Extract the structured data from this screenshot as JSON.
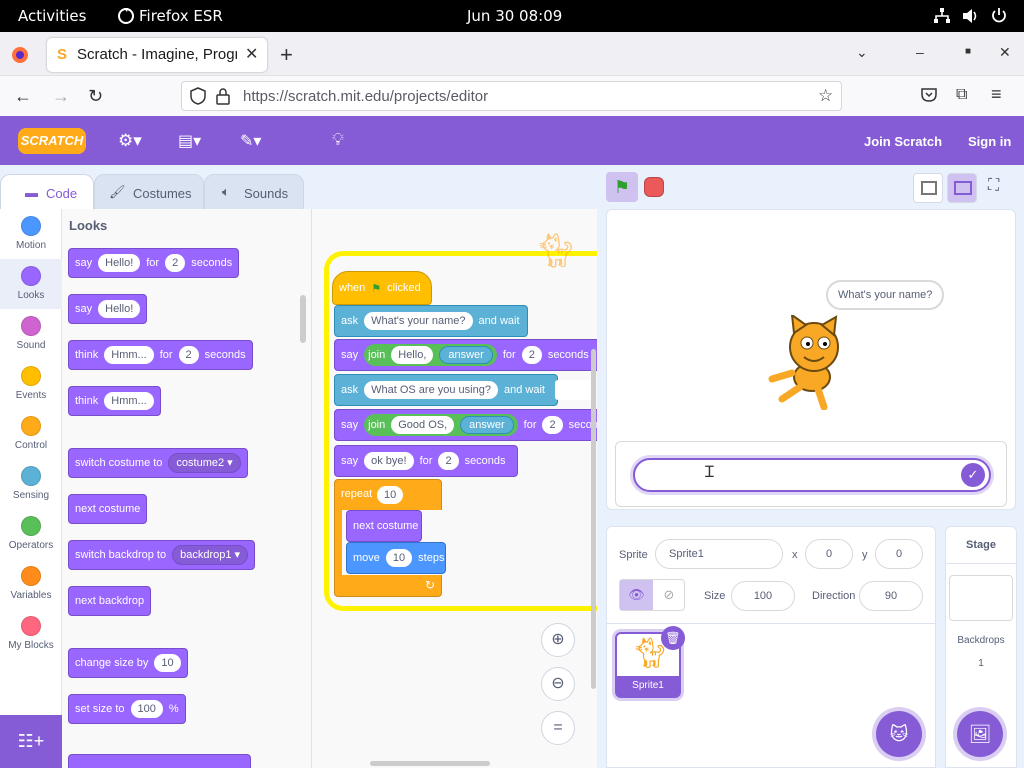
{
  "os": {
    "activities": "Activities",
    "app": "Firefox ESR",
    "clock": "Jun 30  08:09"
  },
  "browser": {
    "tab_title": "Scratch - Imagine, Progra",
    "url": "https://scratch.mit.edu/projects/editor",
    "new_tab": "+"
  },
  "scratch": {
    "logo": "SCRATCH",
    "join": "Join Scratch",
    "signin": "Sign in",
    "tabs": {
      "code": "Code",
      "costumes": "Costumes",
      "sounds": "Sounds"
    },
    "categories": [
      {
        "label": "Motion",
        "color": "#4c97ff"
      },
      {
        "label": "Looks",
        "color": "#9966ff"
      },
      {
        "label": "Sound",
        "color": "#cf63cf"
      },
      {
        "label": "Events",
        "color": "#ffbf00"
      },
      {
        "label": "Control",
        "color": "#ffab19"
      },
      {
        "label": "Sensing",
        "color": "#5cb1d6"
      },
      {
        "label": "Operators",
        "color": "#59c059"
      },
      {
        "label": "Variables",
        "color": "#ff8c1a"
      },
      {
        "label": "My Blocks",
        "color": "#ff6680"
      }
    ],
    "palette": {
      "heading": "Looks",
      "say_for": {
        "say": "say",
        "msg": "Hello!",
        "for": "for",
        "secs": "2",
        "seconds": "seconds"
      },
      "say": {
        "say": "say",
        "msg": "Hello!"
      },
      "think_for": {
        "think": "think",
        "msg": "Hmm...",
        "for": "for",
        "secs": "2",
        "seconds": "seconds"
      },
      "think": {
        "think": "think",
        "msg": "Hmm..."
      },
      "switch_costume": {
        "label": "switch costume to",
        "value": "costume2"
      },
      "next_costume": "next costume",
      "switch_backdrop": {
        "label": "switch backdrop to",
        "value": "backdrop1"
      },
      "next_backdrop": "next backdrop",
      "change_size": {
        "label": "change size by",
        "value": "10"
      },
      "set_size": {
        "label": "set size to",
        "value": "100",
        "unit": "%"
      }
    },
    "script": {
      "hat": {
        "when": "when",
        "clicked": "clicked"
      },
      "ask1": {
        "ask": "ask",
        "q": "What's your name?",
        "and_wait": "and wait"
      },
      "say1": {
        "say": "say",
        "join": "join",
        "a": "Hello,",
        "b": "answer",
        "for": "for",
        "secs": "2",
        "seconds": "seconds"
      },
      "ask2": {
        "ask": "ask",
        "q": "What OS are you using?",
        "and_wait": "and wait"
      },
      "say2": {
        "say": "say",
        "join": "join",
        "a": "Good OS,",
        "b": "answer",
        "for": "for",
        "secs": "2",
        "seconds": "seconds"
      },
      "say3": {
        "say": "say",
        "msg": "ok bye!",
        "for": "for",
        "secs": "2",
        "seconds": "seconds"
      },
      "repeat": {
        "label": "repeat",
        "times": "10"
      },
      "next_costume": "next costume",
      "move": {
        "move": "move",
        "steps_val": "10",
        "steps": "steps"
      }
    },
    "stage": {
      "bubble": "What's your name?",
      "answer_value": ""
    },
    "sprite": {
      "label": "Sprite",
      "name": "Sprite1",
      "x_label": "x",
      "x": "0",
      "y_label": "y",
      "y": "0",
      "size_label": "Size",
      "size": "100",
      "direction_label": "Direction",
      "direction": "90",
      "thumb_name": "Sprite1"
    },
    "stage_panel": {
      "title": "Stage",
      "backdrops_label": "Backdrops",
      "backdrops_count": "1"
    }
  }
}
